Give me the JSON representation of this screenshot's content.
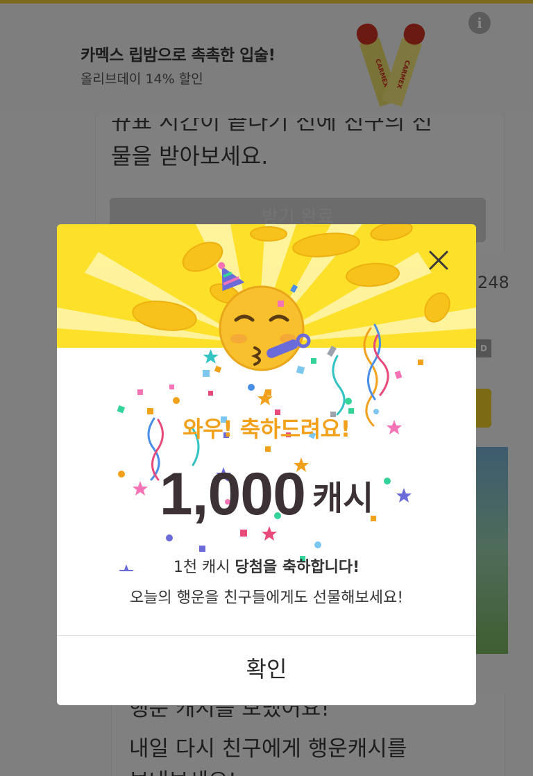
{
  "ad": {
    "title": "카멕스 립밤으로 촉촉한 입술!",
    "subtitle": "올리브데이 14% 할인",
    "info_icon": "info-icon",
    "product_image": "lip-balm-product-image"
  },
  "background_card": {
    "text_line1": "뀨표 시간이 끝나기 전에 친구의 선",
    "text_line2": "물을 받아보세요.",
    "button_label": "받기 완료",
    "count_partial": "248"
  },
  "background_bottom": {
    "line1": "행운 캐시를 보냈어요!",
    "line2": "내일 다시 친구에게 행운캐시를",
    "line3": "보내보세요!"
  },
  "modal": {
    "close_icon": "close-icon",
    "emoji": "party-face-emoji",
    "headline": "와우! 축하드려요!",
    "amount": "1,000",
    "unit": "캐시",
    "message1_prefix": "1천 캐시 ",
    "message1_bold": "당첨을 축하합니다!",
    "message2": "오늘의 행운을 친구들에게도 선물해보세요!",
    "confirm_label": "확인"
  },
  "colors": {
    "hero_yellow": "#fde02a",
    "headline_orange": "#f2a11c",
    "amount_text": "#3c3236",
    "dim_overlay": "#7f7f7f"
  }
}
